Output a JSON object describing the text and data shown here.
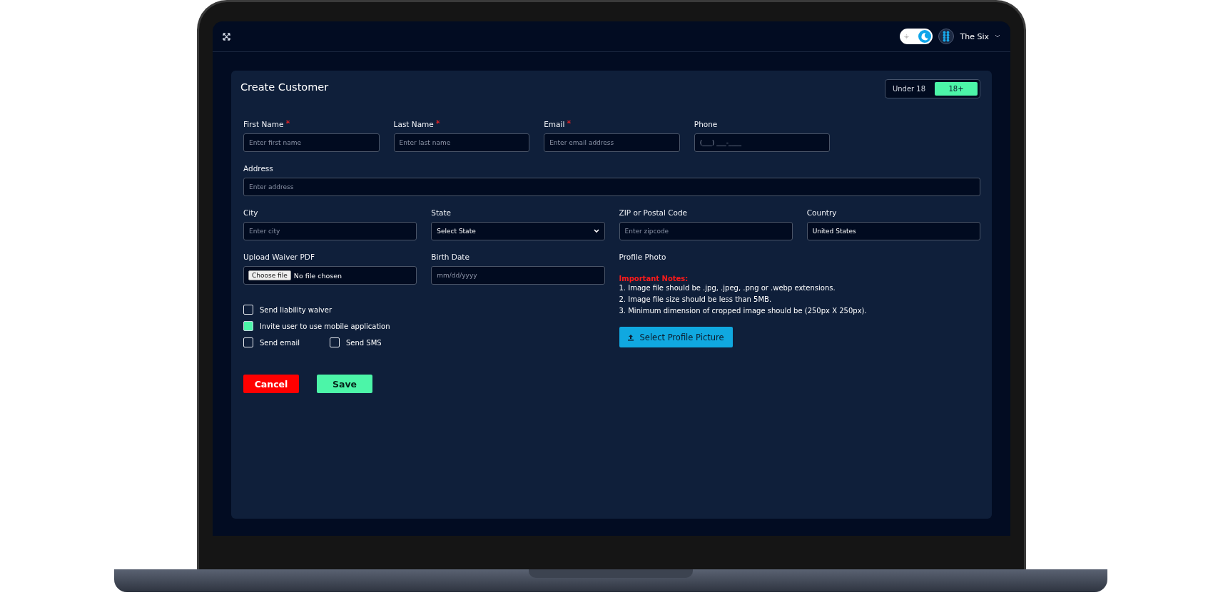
{
  "top_bar": {
    "dark_mode": true,
    "user_name": "The Six"
  },
  "form": {
    "title": "Create Customer",
    "age_toggle": [
      {
        "label": "Under 18",
        "selected": false
      },
      {
        "label": "18+",
        "selected": true
      }
    ],
    "rows": [
      [
        {
          "kind": "text",
          "label": "First Name",
          "required_mark": "*",
          "placeholder": "Enter first name"
        },
        {
          "kind": "text",
          "label": "Last Name",
          "required_mark": "*",
          "placeholder": "Enter last name"
        },
        {
          "kind": "text",
          "label": "Email",
          "required_mark": "*",
          "placeholder": "Enter email address"
        },
        {
          "kind": "text",
          "label": "Phone",
          "placeholder": "(___) ___-____"
        }
      ],
      [
        {
          "kind": "text",
          "label": "Address",
          "placeholder": "Enter address"
        }
      ],
      [
        {
          "kind": "text",
          "label": "City",
          "placeholder": "Enter city"
        },
        {
          "kind": "select",
          "label": "State",
          "value": "Select State"
        },
        {
          "kind": "text",
          "label": "ZIP or Postal Code",
          "placeholder": "Enter zipcode"
        },
        {
          "kind": "text",
          "label": "Country",
          "value": "United States"
        }
      ]
    ],
    "lower_fields": [
      {
        "kind": "file",
        "label": "Upload Waiver PDF",
        "button": "Choose file",
        "status": "No file chosen"
      },
      {
        "kind": "date",
        "label": "Birth Date",
        "placeholder": "mm/dd/yyyy"
      }
    ],
    "checkbox_rows": [
      [
        {
          "label": "Send liability waiver",
          "checked": false
        }
      ],
      [
        {
          "label": "Invite user to use mobile application",
          "checked": true
        }
      ],
      [
        {
          "label": "Send email",
          "checked": false
        },
        {
          "label": "Send SMS",
          "checked": false
        }
      ]
    ],
    "buttons": [
      {
        "kind": "cancel",
        "label": "Cancel"
      },
      {
        "kind": "save",
        "label": "Save"
      }
    ],
    "profile_photo": {
      "label": "Profile Photo",
      "notes_title": "Important Notes:",
      "notes": [
        "1. Image file should be .jpg, .jpeg, .png or .webp extensions.",
        "2. Image file size should be less than 5MB.",
        "3. Minimum dimension of cropped image should be (250px X 250px)."
      ],
      "button": "Select Profile Picture"
    }
  }
}
